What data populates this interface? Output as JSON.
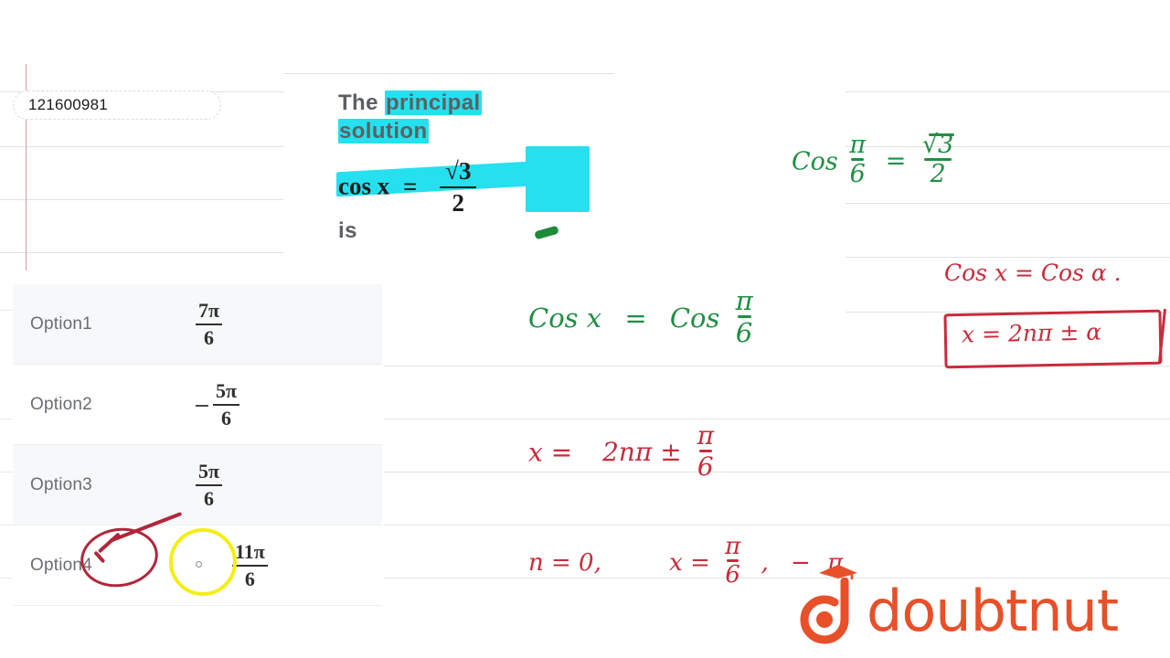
{
  "app": {
    "brand": "doubtnut",
    "brand_color": "#e8502a"
  },
  "question_id_field": {
    "value": "121600981",
    "placeholder": "Question ID"
  },
  "question": {
    "line1_plain": "The ",
    "line1_highlight": "principal",
    "line2_highlight": "solution",
    "equation_lhs": "cos x",
    "equation_eq": "=",
    "equation_num": "√3",
    "equation_den": "2",
    "line4": "is",
    "highlight_color": "#25e0ef",
    "full_text": "The principal solution cos x = √3/2 is"
  },
  "options": [
    {
      "label": "Option1",
      "sign": "",
      "numerator": "7π",
      "denominator": "6",
      "value": "7π/6",
      "shaded": true,
      "selected": false
    },
    {
      "label": "Option2",
      "sign": "−",
      "numerator": "5π",
      "denominator": "6",
      "value": "−5π/6",
      "shaded": false,
      "selected": false
    },
    {
      "label": "Option3",
      "sign": "",
      "numerator": "5π",
      "denominator": "6",
      "value": "5π/6",
      "shaded": true,
      "selected": false
    },
    {
      "label": "Option4",
      "sign": "",
      "numerator": "11π",
      "denominator": "6",
      "value": "11π/6",
      "shaded": false,
      "selected": true
    }
  ],
  "annotations": {
    "selected_option_circle_color": "#b3253a",
    "cursor_circle_color": "#f4ee14",
    "green_ink_color": "#1f8f43",
    "red_ink_color": "#c92b3a",
    "green": {
      "cos_pi6": {
        "lhs": "Cos",
        "frac_num": "π",
        "frac_den": "6",
        "eq": "=",
        "rhs_num": "√3",
        "rhs_den": "2",
        "text": "Cos π/6 = √3/2 ."
      },
      "cos_x": {
        "lhs": "Cos x",
        "eq": "=",
        "rhs": "Cos",
        "frac_num": "π",
        "frac_den": "6",
        "text": "Cos x = Cos π/6"
      }
    },
    "red": {
      "cos_alpha": {
        "text": "Cos x = Cos α ."
      },
      "boxed_formula": {
        "text": "x = 2nπ ± α"
      },
      "general_solution": {
        "lhs": "x =",
        "rhs": "2nπ ±",
        "frac_num": "π",
        "frac_den": "6",
        "text": "x = 2nπ ± π/6 ."
      },
      "substitution": {
        "n_value": "n = 0,",
        "x_label": "x =",
        "frac_num": "π",
        "frac_den": "6",
        "comma": ",",
        "minus": "−",
        "second_num": "π",
        "text": "n = 0,   x = π/6 ,  − π/6"
      }
    }
  }
}
